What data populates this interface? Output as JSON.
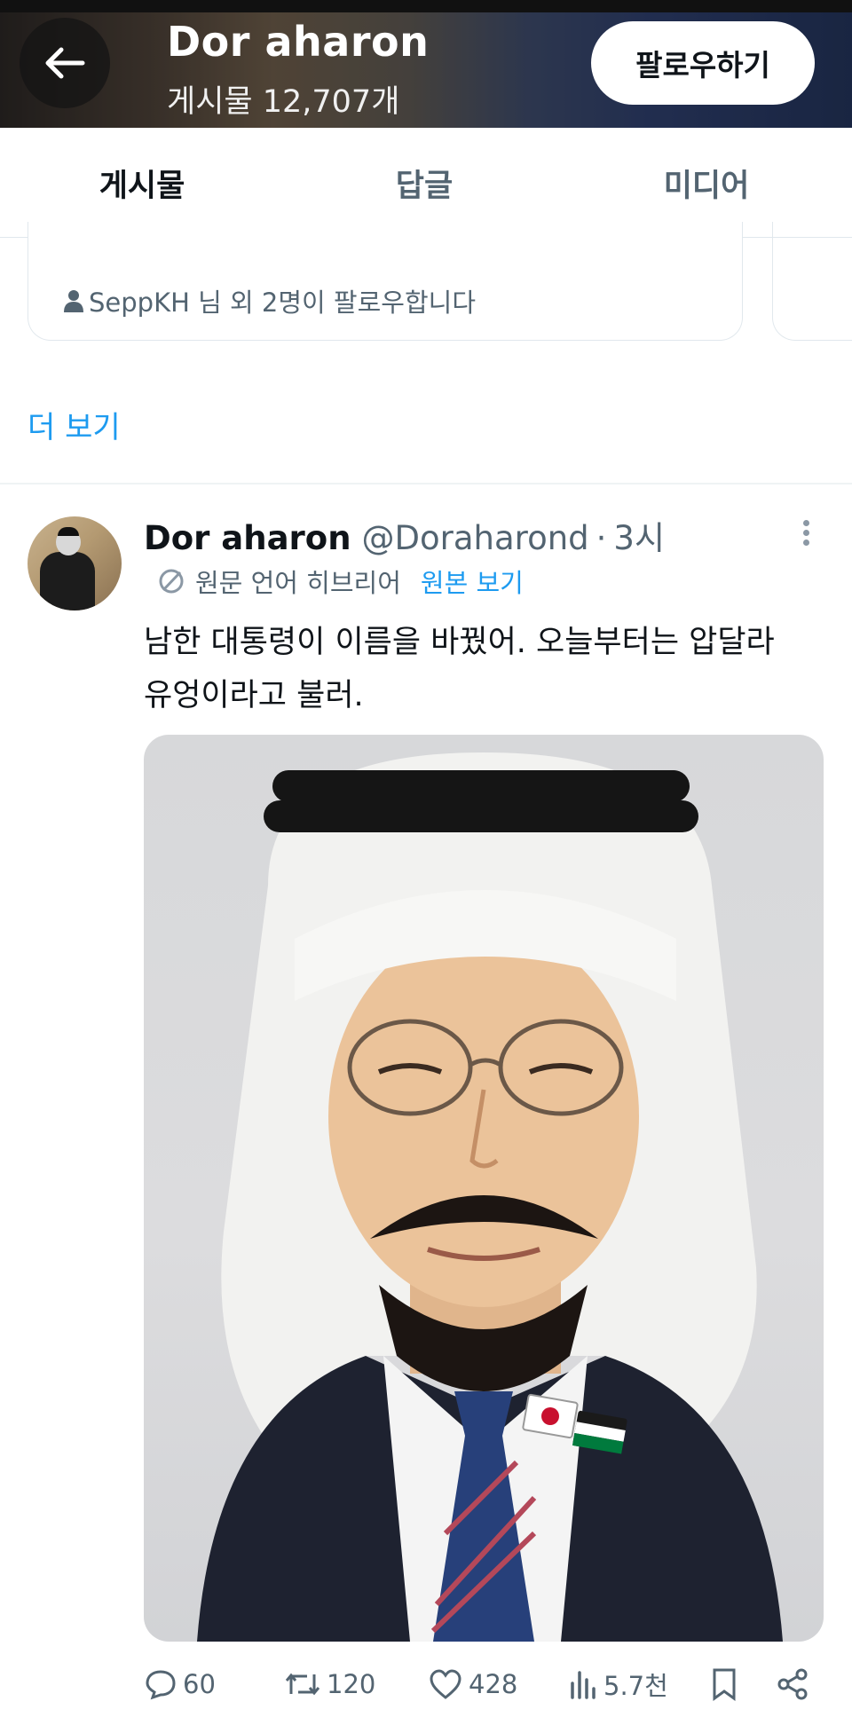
{
  "header": {
    "title": "Dor aharon",
    "post_count": "게시물 12,707개",
    "follow_label": "팔로우하기"
  },
  "tabs": [
    {
      "label": "게시물",
      "active": true
    },
    {
      "label": "답글",
      "active": false
    },
    {
      "label": "미디어",
      "active": false
    }
  ],
  "suggestion": {
    "followed_by": "SeppKH 님 외 2명이 팔로우합니다",
    "see_more": "더 보기"
  },
  "tweet": {
    "name": "Dor aharon",
    "handle": "@Doraharond",
    "separator": "·",
    "time": "3시",
    "translated_from": "원문 언어 히브리어",
    "show_original": "원본 보기",
    "text_line1": "남한 대통령이 이름을 바꿨어. 오늘부터는 압달라",
    "text_line2": "유엉이라고 불러.",
    "actions": {
      "replies": "60",
      "reposts": "120",
      "likes": "428",
      "views": "5.7천"
    }
  },
  "colors": {
    "accent": "#1d9bf0",
    "text_primary": "#0f1419",
    "text_secondary": "#536471"
  },
  "icons": [
    "back-arrow-icon",
    "person-icon",
    "translate-icon",
    "more-dots-icon",
    "reply-icon",
    "repost-icon",
    "like-icon",
    "views-icon",
    "bookmark-icon",
    "share-icon"
  ]
}
